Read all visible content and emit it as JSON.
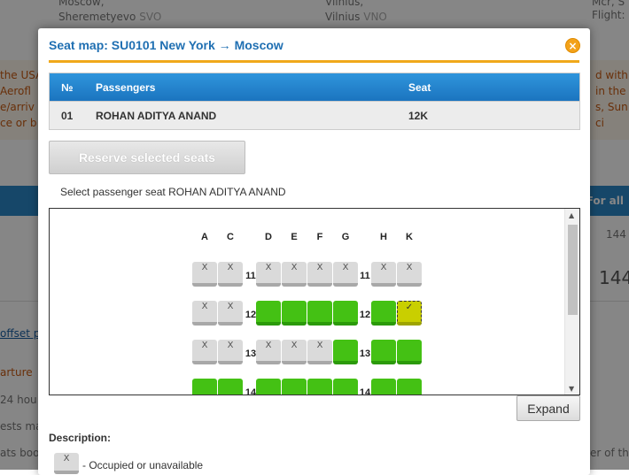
{
  "background": {
    "from_city": "Moscow,",
    "from_airport": "Sheremetyevo",
    "from_code": "SVO",
    "to_city": "Vilnius,",
    "to_airport": "Vilnius",
    "to_code": "VNO",
    "right_top_1": "Mcr, S",
    "right_top_2": "Flight: S",
    "left_fragment_1": "the USA",
    "left_fragment_2": "Aerofl",
    "left_fragment_3": "e/arriv",
    "left_fragment_4": "ce or b",
    "right_fragment_1": "d with",
    "right_fragment_2": "in the",
    "right_fragment_3": "s, Sun",
    "right_fragment_4": "ci",
    "strip_label": "For all",
    "price_small": "144",
    "price_big": "144",
    "offset_link": "offset pro",
    "departure": "arture",
    "hours": "24 hou",
    "guests": "ests ma",
    "seats_boo": "ats boo",
    "right_bottom": "er of th"
  },
  "modal": {
    "title": "Seat map: SU0101 New York → Moscow",
    "close_glyph": "×",
    "table": {
      "headers": {
        "num": "№",
        "passengers": "Passengers",
        "seat": "Seat"
      },
      "rows": [
        {
          "num": "01",
          "name": "ROHAN ADITYA ANAND",
          "seat": "12K"
        }
      ]
    },
    "reserve_label": "Reserve selected seats",
    "select_label": "Select passenger seat  ROHAN ADITYA ANAND",
    "seatmap": {
      "columns": [
        "A",
        "C",
        "D",
        "E",
        "F",
        "G",
        "H",
        "K"
      ],
      "rows": [
        {
          "number": "11",
          "seats": [
            "occupied",
            "occupied",
            "occupied",
            "occupied",
            "occupied",
            "occupied",
            "occupied",
            "occupied"
          ]
        },
        {
          "number": "12",
          "seats": [
            "occupied",
            "occupied",
            "free",
            "free",
            "free",
            "free",
            "free",
            "selected"
          ]
        },
        {
          "number": "13",
          "seats": [
            "occupied",
            "occupied",
            "occupied",
            "occupied",
            "occupied",
            "free",
            "free",
            "free"
          ]
        },
        {
          "number": "14",
          "seats": [
            "free",
            "free",
            "free",
            "free",
            "free",
            "free",
            "free",
            "free"
          ]
        }
      ],
      "occupied_glyph": "X",
      "selected_glyph": "✓"
    },
    "expand_label": "Expand",
    "description_label": "Description:",
    "legend": [
      {
        "glyph": "X",
        "text": "- Occupied or unavailable"
      }
    ]
  },
  "colors": {
    "title_blue": "#1f6fb2",
    "accent_orange": "#f0a81a",
    "seat_free": "#44c114",
    "seat_selected": "#c9cf00",
    "seat_occupied": "#dadada"
  }
}
